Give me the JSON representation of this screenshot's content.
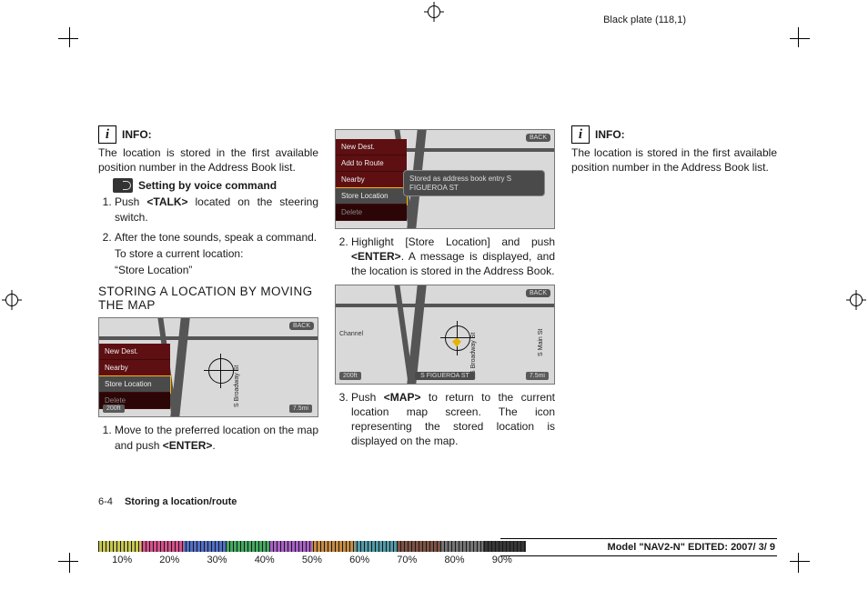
{
  "plate_tag": "Black plate (118,1)",
  "col1": {
    "info_label": "INFO:",
    "info_text": "The location is stored in the first available position number in the Address Book list.",
    "voice_title": "Setting by voice command",
    "step1_pre": "Push ",
    "step1_btn": "<TALK>",
    "step1_post": " located on the steering switch.",
    "step2": "After the tone sounds, speak a command.",
    "step2_sub_a": "To store a current location:",
    "step2_sub_b": "“Store Location”",
    "section_title": "STORING A LOCATION BY MOVING THE MAP",
    "screen": {
      "menu_items": [
        "New Dest.",
        "Nearby",
        "Store Location",
        "Delete"
      ],
      "back": "BACK",
      "scale": "200ft",
      "dist": "7.5mi",
      "street_a": "S Broadway St"
    },
    "under_step_pre": "Move to the preferred location on the map and push ",
    "under_step_btn": "<ENTER>",
    "under_step_post": "."
  },
  "col2": {
    "screen_top": {
      "menu_items": [
        "New Dest.",
        "Add to Route",
        "Nearby",
        "Store Location",
        "Delete"
      ],
      "toast_l1": "Stored as address book entry S",
      "toast_l2": "FIGUEROA ST",
      "back": "BACK"
    },
    "step2_pre": "Highlight [Store Location] and push ",
    "step2_btn": "<ENTER>",
    "step2_post": ". A message is displayed, and the location is stored in the Address Book.",
    "screen_bot": {
      "back": "BACK",
      "scale": "200ft",
      "dist": "7.5mi",
      "street_a": "S Broadway St",
      "street_b": "S Main St",
      "banner": "S FIGUEROA ST",
      "channel": "Channel"
    },
    "step3_pre": "Push ",
    "step3_btn": "<MAP>",
    "step3_post": " to return to the current location map screen. The icon representing the stored location is displayed on the map."
  },
  "col3": {
    "info_label": "INFO:",
    "info_text": "The location is stored in the first available position number in the Address Book list."
  },
  "footer": {
    "page_num": "6-4",
    "chapter": "Storing a location/route",
    "model_pre": "Model ",
    "model_quote_open": "\"",
    "model_name": "NAV2-N",
    "model_quote_close": "\"",
    "edited": " EDITED: 2007/ 3/ 9"
  },
  "ruler_pct": [
    "10%",
    "20%",
    "30%",
    "40%",
    "50%",
    "60%",
    "70%",
    "80%",
    "90%"
  ]
}
